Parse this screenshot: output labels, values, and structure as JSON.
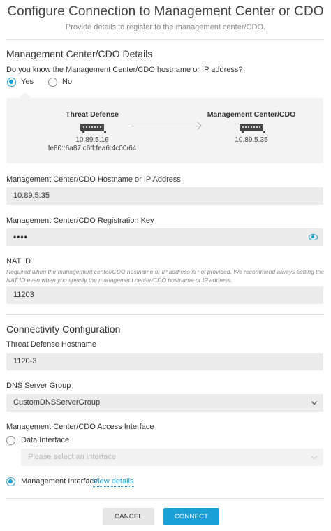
{
  "header": {
    "title": "Configure Connection to Management Center or CDO",
    "subtitle": "Provide details to register to the management center/CDO."
  },
  "details": {
    "section_title": "Management Center/CDO Details",
    "question": "Do you know the Management Center/CDO hostname or IP address?",
    "yes_label": "Yes",
    "no_label": "No",
    "selected": "Yes"
  },
  "diagram": {
    "left_title": "Threat Defense",
    "left_ipv4": "10.89.5.16",
    "left_ipv6": "fe80::6a87:c6ff:fea6:4c00/64",
    "right_title": "Management Center/CDO",
    "right_ip": "10.89.5.35"
  },
  "hostname": {
    "label": "Management Center/CDO Hostname or IP Address",
    "value": "10.89.5.35"
  },
  "regkey": {
    "label": "Management Center/CDO Registration Key",
    "value": "••••"
  },
  "natid": {
    "label": "NAT ID",
    "help": "Required when the management center/CDO hostname or IP address is not provided. We recommend always setting the NAT ID even when you specify the management center/CDO hostname or IP address.",
    "value": "11203"
  },
  "connectivity": {
    "section_title": "Connectivity Configuration",
    "hostname_label": "Threat Defense Hostname",
    "hostname_value": "1120-3",
    "dns_label": "DNS Server Group",
    "dns_value": "CustomDNSServerGroup",
    "access_label": "Management Center/CDO Access Interface",
    "data_interface_label": "Data Interface",
    "interface_placeholder": "Please select an interface",
    "mgmt_interface_label": "Management Interface",
    "view_details": "View details",
    "selected": "Management Interface"
  },
  "footer": {
    "cancel": "CANCEL",
    "connect": "CONNECT"
  },
  "colors": {
    "accent": "#1ba0d7",
    "field_bg": "#ececec"
  }
}
